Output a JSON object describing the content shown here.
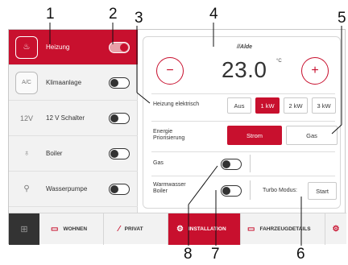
{
  "callouts": [
    "1",
    "2",
    "3",
    "4",
    "5",
    "6",
    "7",
    "8"
  ],
  "left_panel": {
    "items": [
      {
        "icon": "heater-icon",
        "glyph": "♨",
        "label": "Heizung",
        "toggle_on": true,
        "active": true
      },
      {
        "icon": "ac-icon",
        "glyph": "A/C",
        "label": "Klimaanlage",
        "toggle_on": false,
        "active": false
      },
      {
        "icon": "12v-icon",
        "glyph": "12V",
        "label": "12 V Schalter",
        "toggle_on": false,
        "active": false
      },
      {
        "icon": "boiler-icon",
        "glyph": "♁",
        "label": "Boiler",
        "toggle_on": false,
        "active": false
      },
      {
        "icon": "water-pump-icon",
        "glyph": "⚲",
        "label": "Wasserpumpe",
        "toggle_on": false,
        "active": false
      }
    ]
  },
  "control": {
    "brand": "//Alde",
    "minus": "−",
    "plus": "+",
    "temperature": "23.0",
    "unit": "°C",
    "heizung_elektrisch": {
      "label": "Heizung elektrisch",
      "options": [
        "Aus",
        "1 kW",
        "2 kW",
        "3 kW"
      ],
      "selected": "1 kW"
    },
    "energie": {
      "label": "Energie Priorisierung",
      "options": [
        "Strom",
        "Gas"
      ],
      "selected": "Strom"
    },
    "gas": {
      "label": "Gas",
      "on": false
    },
    "warmwasser": {
      "label": "Warmwasser Boiler",
      "on": false
    },
    "turbo_label": "Turbo Modus:",
    "start_label": "Start"
  },
  "nav": {
    "grid_glyph": "⊞",
    "items": [
      {
        "label": "WOHNEN",
        "glyph": "▭",
        "active": false
      },
      {
        "label": "PRIVAT",
        "glyph": "⁄",
        "active": false
      },
      {
        "label": "INSTALLATION",
        "glyph": "⚙",
        "active": true
      },
      {
        "label": "FAHRZEUGDETAILS",
        "glyph": "▭",
        "active": false
      }
    ],
    "settings_glyph": "⚙"
  },
  "colors": {
    "accent": "#c8102e"
  }
}
